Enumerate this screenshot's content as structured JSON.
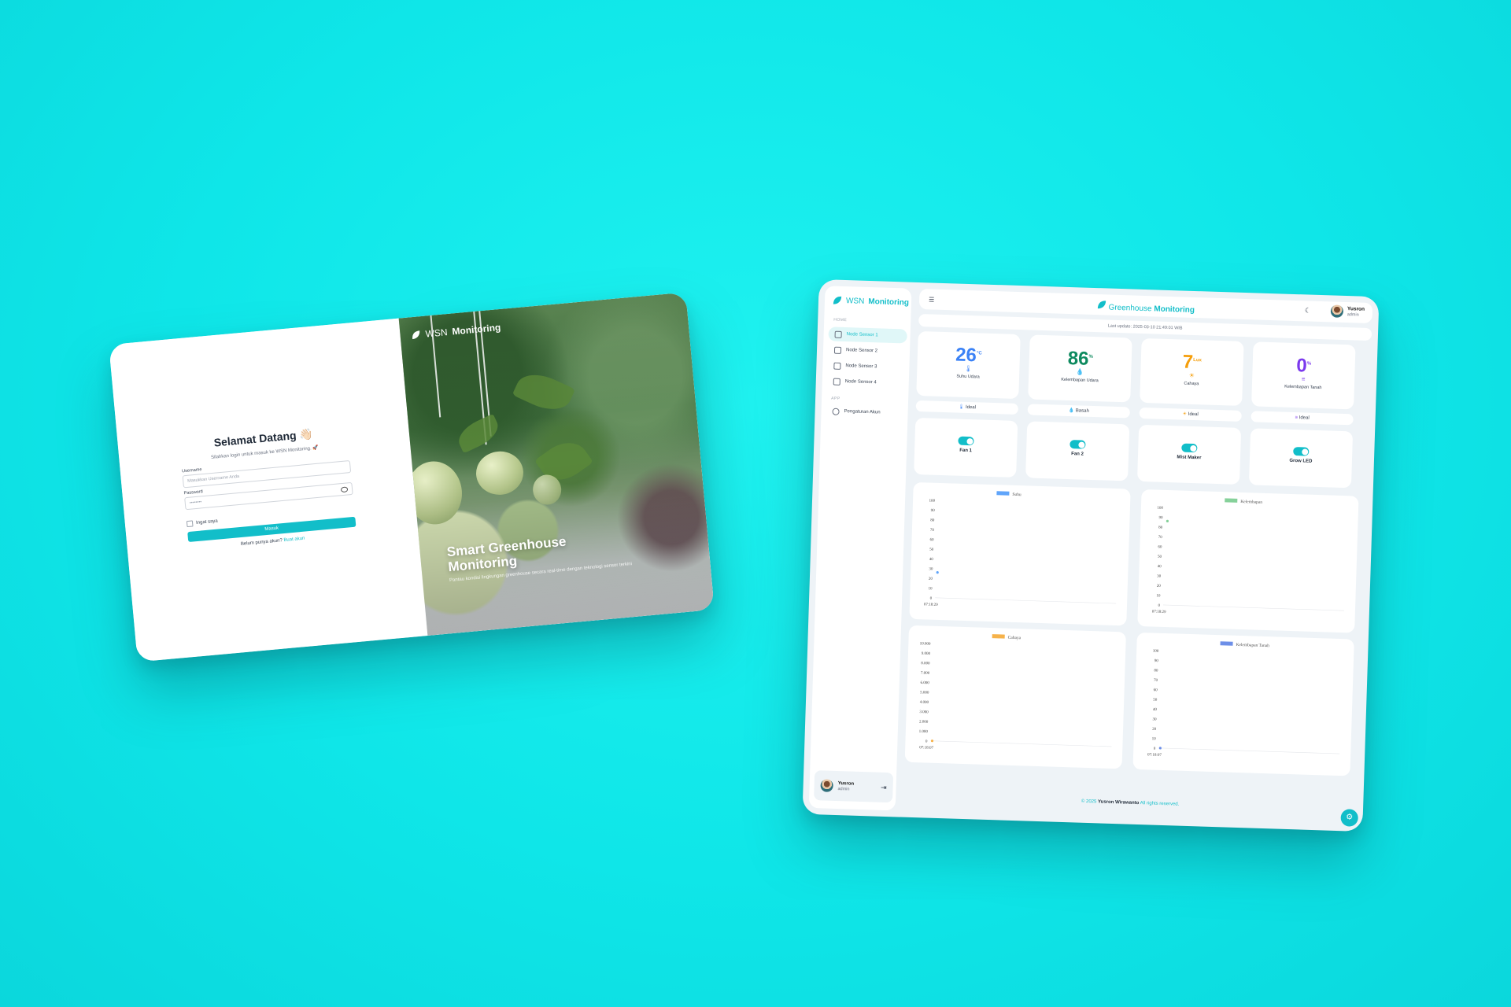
{
  "login": {
    "brand_prefix": "WSN",
    "brand_suffix": "Monitoring",
    "title": "Selamat Datang 👋🏻",
    "subtitle": "Silahkan login untuk masuk ke WSN Monitoring. 🚀",
    "username_label": "Username",
    "username_placeholder": "Masukkan Username Anda",
    "password_label": "Password",
    "password_placeholder": "••••••••",
    "remember_label": "Ingat saya",
    "submit_label": "Masuk",
    "register_prompt": "Belum punya akun?",
    "register_link": "Buat akun",
    "hero_title": "Smart Greenhouse Monitoring",
    "hero_subtitle": "Pantau kondisi lingkungan greenhouse secara real-time dengan teknologi sensor terkini"
  },
  "dashboard": {
    "sidebar": {
      "brand_prefix": "WSN",
      "brand_suffix": "Monitoring",
      "section_home": "HOME",
      "items": [
        {
          "label": "Node Sensor 1",
          "active": true
        },
        {
          "label": "Node Sensor 2",
          "active": false
        },
        {
          "label": "Node Sensor 3",
          "active": false
        },
        {
          "label": "Node Sensor 4",
          "active": false
        }
      ],
      "section_app": "APP",
      "settings_label": "Pengaturan Akun",
      "user_name": "Yusron",
      "user_role": "admin"
    },
    "topbar": {
      "title_prefix": "Greenhouse",
      "title_suffix": "Monitoring",
      "user_name": "Yusron",
      "user_role": "admin"
    },
    "last_update": "Last update: 2025-03-10 21:49:01 WIB",
    "stats": [
      {
        "value": "26",
        "unit": "°C",
        "label": "Suhu Udara",
        "color": "#3b82f6",
        "icon": "🌡",
        "status": "Ideal",
        "status_icon": "🌡"
      },
      {
        "value": "86",
        "unit": "%",
        "label": "Kelembapan Udara",
        "color": "#0e8a5f",
        "icon": "💧",
        "status": "Basah",
        "status_icon": "💧"
      },
      {
        "value": "7",
        "unit": "Lux",
        "label": "Cahaya",
        "color": "#f59e0b",
        "icon": "☀",
        "status": "Ideal",
        "status_icon": "☀"
      },
      {
        "value": "0",
        "unit": "%",
        "label": "Kelembapan Tanah",
        "color": "#7c3aed",
        "icon": "≡",
        "status": "Ideal",
        "status_icon": "≡"
      }
    ],
    "controls": [
      {
        "label": "Fan 1",
        "on": true
      },
      {
        "label": "Fan 2",
        "on": true
      },
      {
        "label": "Mist Maker",
        "on": true
      },
      {
        "label": "Grow LED",
        "on": true
      }
    ],
    "footer_prefix": "© 2025",
    "footer_name": "Yusron Wirawanto",
    "footer_suffix": "All rights reserved.",
    "colors": {
      "accent": "#12bec9"
    }
  },
  "chart_data": [
    {
      "type": "line",
      "legend": "Suhu",
      "color": "#60a5fa",
      "x": [
        "07:18:29"
      ],
      "y": [
        26
      ],
      "ylim": [
        0,
        100
      ],
      "yticks": [
        "100",
        "90",
        "80",
        "70",
        "60",
        "50",
        "40",
        "30",
        "20",
        "10",
        "0"
      ]
    },
    {
      "type": "line",
      "legend": "Kelembapan",
      "color": "#86d19a",
      "x": [
        "07:18:29"
      ],
      "y": [
        86
      ],
      "ylim": [
        0,
        100
      ],
      "yticks": [
        "100",
        "90",
        "80",
        "70",
        "60",
        "50",
        "40",
        "30",
        "20",
        "10",
        "0"
      ]
    },
    {
      "type": "line",
      "legend": "Cahaya",
      "color": "#f6b24a",
      "x": [
        "07:18:07"
      ],
      "y": [
        7
      ],
      "ylim": [
        0,
        10000
      ],
      "yticks": [
        "10.000",
        "9.000",
        "8.000",
        "7.000",
        "6.000",
        "5.000",
        "4.000",
        "3.000",
        "2.000",
        "1.000",
        "0"
      ]
    },
    {
      "type": "line",
      "legend": "Kelembapan Tanah",
      "color": "#6d8fe8",
      "x": [
        "07:18:07"
      ],
      "y": [
        0
      ],
      "ylim": [
        0,
        100
      ],
      "yticks": [
        "100",
        "90",
        "80",
        "70",
        "60",
        "50",
        "40",
        "30",
        "20",
        "10",
        "0"
      ]
    }
  ]
}
